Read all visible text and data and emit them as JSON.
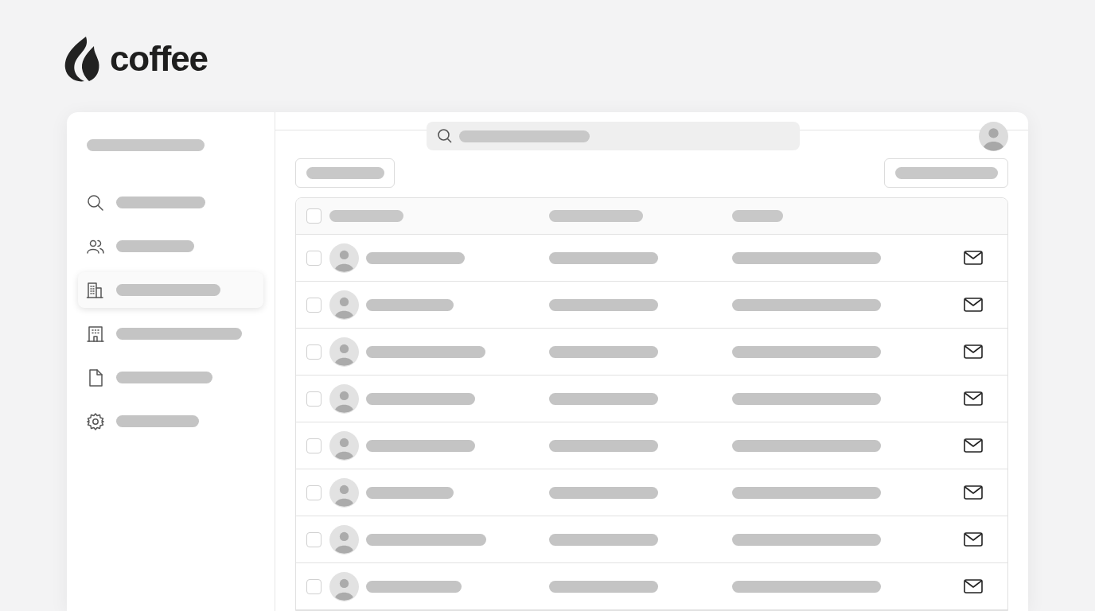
{
  "logo": {
    "text": "coffee"
  },
  "sidebar": {
    "items": [
      {
        "kind": "search",
        "selected": false
      },
      {
        "kind": "people",
        "selected": false
      },
      {
        "kind": "buildings",
        "selected": true
      },
      {
        "kind": "building",
        "selected": false
      },
      {
        "kind": "document",
        "selected": false
      },
      {
        "kind": "settings",
        "selected": false
      }
    ]
  },
  "table": {
    "header": {
      "checked": false
    },
    "rows": [
      {
        "checked": false
      },
      {
        "checked": false
      },
      {
        "checked": false
      },
      {
        "checked": false
      },
      {
        "checked": false
      },
      {
        "checked": false
      },
      {
        "checked": false
      },
      {
        "checked": false
      }
    ]
  }
}
